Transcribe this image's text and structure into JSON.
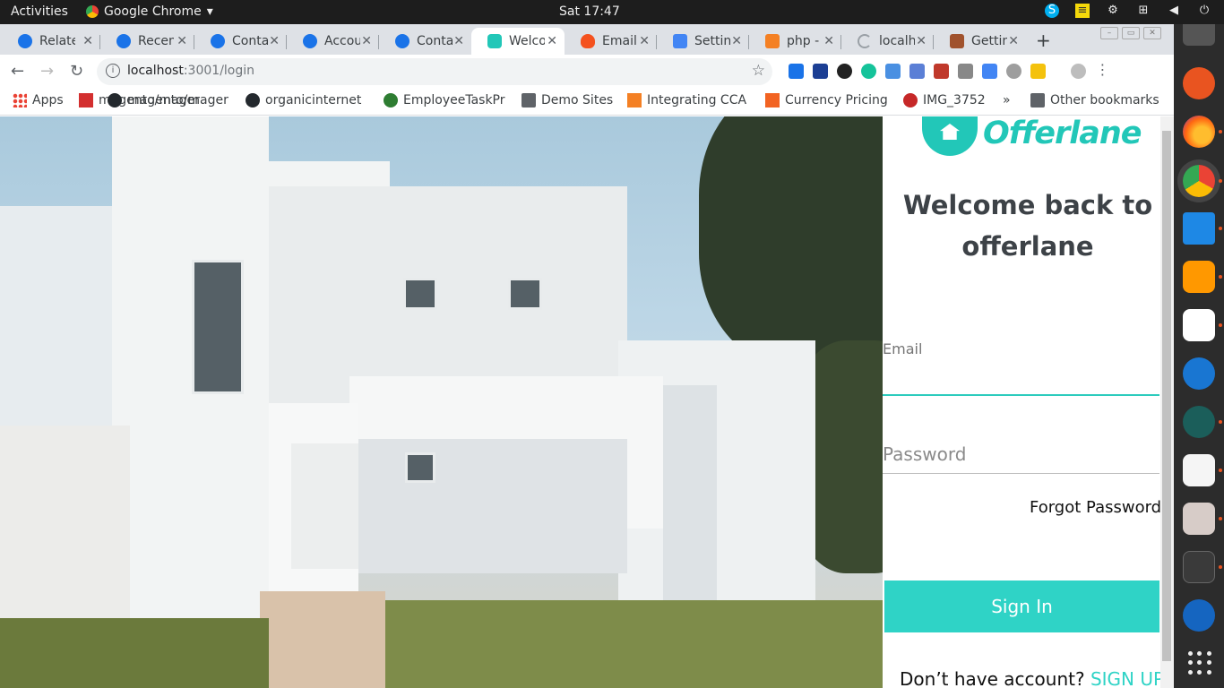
{
  "os": {
    "activities": "Activities",
    "app_name": "Google Chrome",
    "clock": "Sat 17:47"
  },
  "tabs": [
    {
      "label": "Relate",
      "color": "#1a73e8"
    },
    {
      "label": "Recen",
      "color": "#1a73e8"
    },
    {
      "label": "Conta",
      "color": "#1a73e8"
    },
    {
      "label": "Accou",
      "color": "#1a73e8"
    },
    {
      "label": "Conta",
      "color": "#1a73e8"
    },
    {
      "label": "Welco",
      "color": "#22c7b8",
      "active": true
    },
    {
      "label": "Email",
      "color": "#f4511e"
    },
    {
      "label": "Settin",
      "color": "#4285f4"
    },
    {
      "label": "php -",
      "color": "#f48024"
    },
    {
      "label": "localh",
      "color": "#9aa0a6"
    },
    {
      "label": "Gettin",
      "color": "#a0522d"
    }
  ],
  "toolbar": {
    "url_host": "localhost",
    "url_path": ":3001/login"
  },
  "bookmarks": {
    "apps": "Apps",
    "items": [
      "magento/mager",
      "organicinternet",
      "EmployeeTaskPr",
      "Demo Sites",
      "Integrating CCA",
      "Currency Pricing",
      "IMG_3752"
    ],
    "more": "»",
    "other": "Other bookmarks"
  },
  "login": {
    "brand": "Offerlane",
    "welcome_line1": "Welcome back to",
    "welcome_line2": "offerlane",
    "email_label": "Email",
    "email_value": "",
    "password_placeholder": "Password",
    "forgot": "Forgot Password",
    "sign_in": "Sign In",
    "no_account": "Don’t have account?",
    "sign_up": "SIGN UP"
  },
  "colors": {
    "accent": "#2fd3c6",
    "heading": "#3d4247"
  }
}
